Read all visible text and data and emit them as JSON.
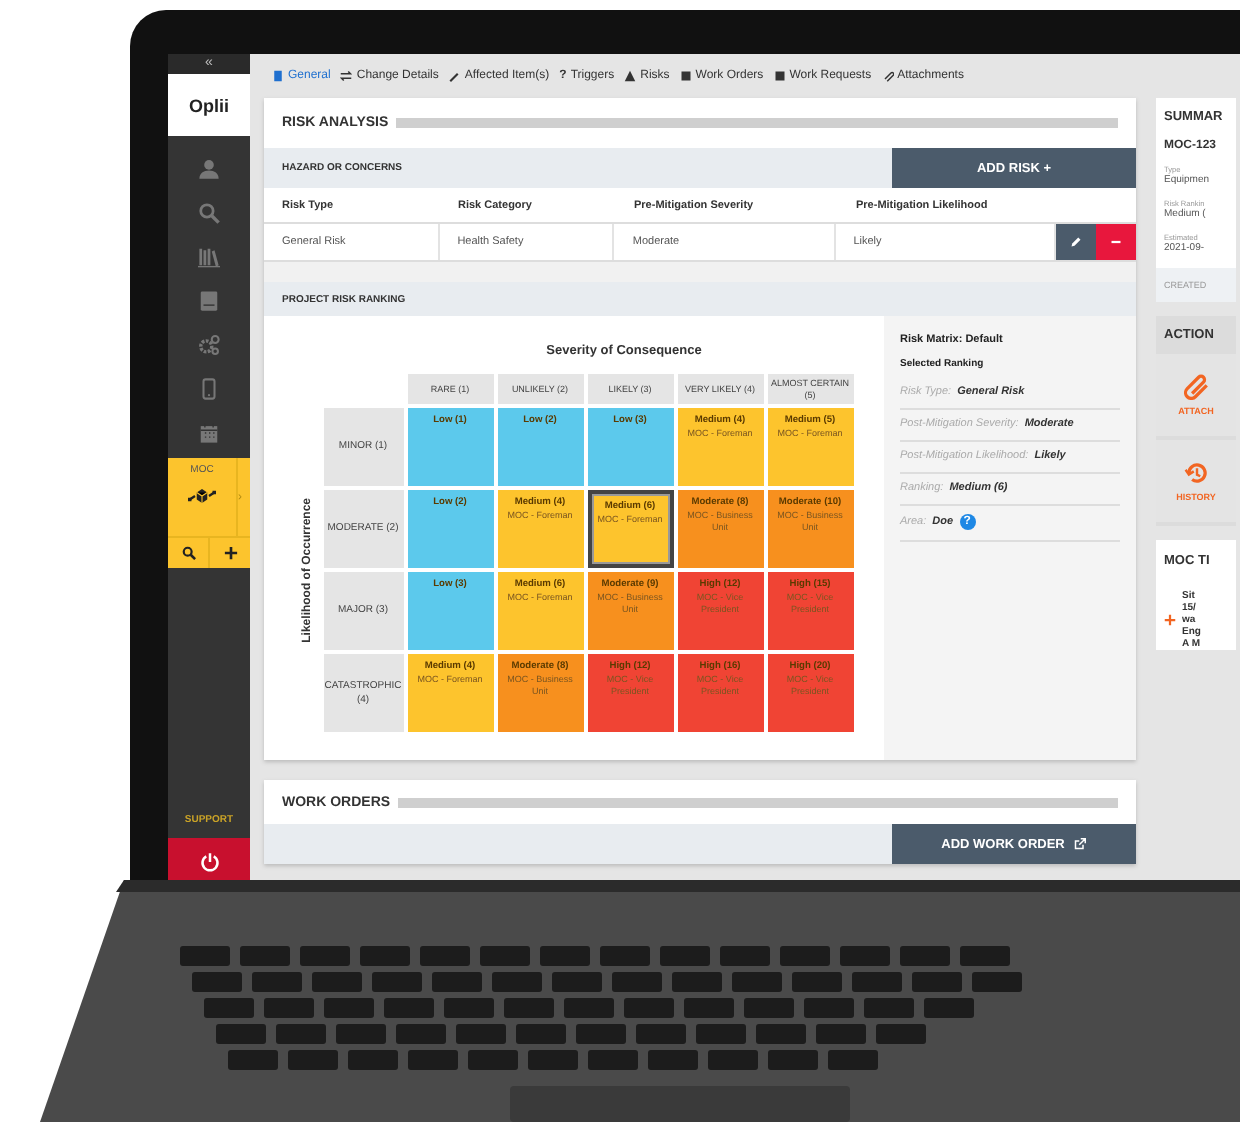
{
  "sidebar": {
    "collapse": "«",
    "logo": "Oplii",
    "module": {
      "label": "MOC",
      "expand": "›"
    },
    "support": "SUPPORT"
  },
  "tabs": [
    {
      "label": "General",
      "selected": true
    },
    {
      "label": "Change Details",
      "selected": false
    },
    {
      "label": "Affected Item(s)",
      "selected": false
    },
    {
      "label": "Triggers",
      "selected": false,
      "icon_text": "?"
    },
    {
      "label": "Risks",
      "selected": false
    },
    {
      "label": "Work Orders",
      "selected": false
    },
    {
      "label": "Work Requests",
      "selected": false
    },
    {
      "label": "Attachments",
      "selected": false
    }
  ],
  "risk_analysis": {
    "title": "RISK ANALYSIS",
    "section": "HAZARD OR CONCERNS",
    "add_button": "ADD RISK +",
    "columns": [
      "Risk Type",
      "Risk Category",
      "Pre-Mitigation Severity",
      "Pre-Mitigation Likelihood"
    ],
    "rows": [
      [
        "General Risk",
        "Health Safety",
        "Moderate",
        "Likely"
      ]
    ]
  },
  "risk_ranking": {
    "title": "PROJECT RISK RANKING",
    "x_title": "Severity of Consequence",
    "y_title": "Likelihood of Occurrence",
    "columns": [
      "RARE (1)",
      "UNLIKELY (2)",
      "LIKELY (3)",
      "VERY LIKELY (4)",
      "ALMOST CERTAIN (5)"
    ],
    "rows": [
      {
        "label": "MINOR (1)",
        "cells": [
          {
            "title": "Low (1)",
            "color": "#5cc9ec",
            "selected": false
          },
          {
            "title": "Low (2)",
            "color": "#5cc9ec",
            "selected": false
          },
          {
            "title": "Low (3)",
            "color": "#5cc9ec",
            "selected": false
          },
          {
            "title": "Medium (4)",
            "note": "MOC - Foreman",
            "color": "#fdc42d",
            "selected": false
          },
          {
            "title": "Medium (5)",
            "note": "MOC - Foreman",
            "color": "#fdc42d",
            "selected": false
          }
        ]
      },
      {
        "label": "MODERATE (2)",
        "cells": [
          {
            "title": "Low (2)",
            "color": "#5cc9ec",
            "selected": false
          },
          {
            "title": "Medium (4)",
            "note": "MOC - Foreman",
            "color": "#fdc42d",
            "selected": false
          },
          {
            "title": "Medium (6)",
            "note": "MOC - Foreman",
            "color": "#fdc42d",
            "selected": true
          },
          {
            "title": "Moderate (8)",
            "note": "MOC - Business Unit",
            "color": "#f7901e",
            "selected": false
          },
          {
            "title": "Moderate (10)",
            "note": "MOC - Business Unit",
            "color": "#f7901e",
            "selected": false
          }
        ]
      },
      {
        "label": "MAJOR (3)",
        "cells": [
          {
            "title": "Low (3)",
            "color": "#5cc9ec",
            "selected": false
          },
          {
            "title": "Medium (6)",
            "note": "MOC - Foreman",
            "color": "#fdc42d",
            "selected": false
          },
          {
            "title": "Moderate (9)",
            "note": "MOC - Business Unit",
            "color": "#f7901e",
            "selected": false
          },
          {
            "title": "High (12)",
            "note": "MOC - Vice President",
            "color": "#f04434",
            "selected": false
          },
          {
            "title": "High (15)",
            "note": "MOC - Vice President",
            "color": "#f04434",
            "selected": false
          }
        ]
      },
      {
        "label": "CATASTROPHIC (4)",
        "cells": [
          {
            "title": "Medium (4)",
            "note": "MOC - Foreman",
            "color": "#fdc42d",
            "selected": false
          },
          {
            "title": "Moderate (8)",
            "note": "MOC - Business Unit",
            "color": "#f7901e",
            "selected": false
          },
          {
            "title": "High (12)",
            "note": "MOC - Vice President",
            "color": "#f04434",
            "selected": false
          },
          {
            "title": "High (16)",
            "note": "MOC - Vice President",
            "color": "#f04434",
            "selected": false
          },
          {
            "title": "High (20)",
            "note": "MOC - Vice President",
            "color": "#f04434",
            "selected": false
          }
        ]
      }
    ]
  },
  "details": {
    "matrix": "Risk Matrix: Default",
    "heading": "Selected Ranking",
    "fields": [
      {
        "label": "Risk Type:",
        "value": "General Risk"
      },
      {
        "label": "Post-Mitigation Severity:",
        "value": "Moderate"
      },
      {
        "label": "Post-Mitigation Likelihood:",
        "value": "Likely"
      },
      {
        "label": "Ranking:",
        "value": "Medium (6)"
      },
      {
        "label": "Area:",
        "value": "Doe",
        "help": "?"
      }
    ]
  },
  "work_orders": {
    "title": "WORK ORDERS",
    "add_button": "ADD WORK ORDER"
  },
  "summary": {
    "title": "SUMMAR",
    "id": "MOC-123",
    "fields": [
      {
        "label": "Type",
        "value": "Equipmen"
      },
      {
        "label": "Risk Rankin",
        "value": "Medium ("
      },
      {
        "label": "Estimated",
        "value": "2021-09-"
      }
    ],
    "created": "CREATED",
    "actions_title": "ACTION",
    "actions": [
      "ATTACH",
      "HISTORY"
    ],
    "timeline_title": "MOC TI",
    "timeline": [
      "Sit",
      "15/",
      "wa",
      "Eng",
      "A M"
    ]
  }
}
